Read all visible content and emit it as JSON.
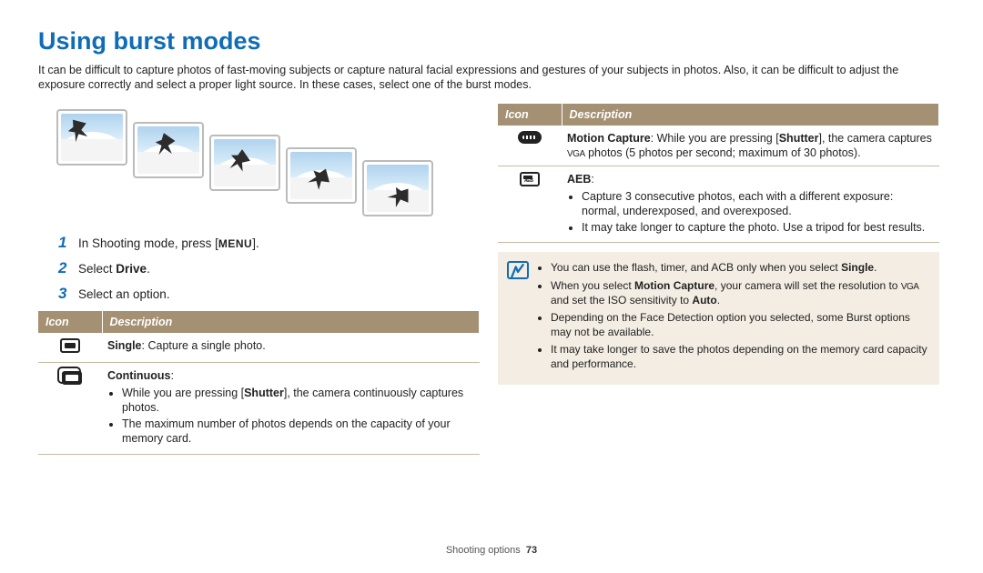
{
  "title": "Using burst modes",
  "intro": "It can be difficult to capture photos of fast-moving subjects or capture natural facial expressions and gestures of your subjects in photos. Also, it can be difficult to adjust the exposure correctly and select a proper light source. In these cases, select one of the burst modes.",
  "steps": {
    "n1": "1",
    "s1_pre": "In Shooting mode, press [",
    "s1_menu": "MENU",
    "s1_post": "].",
    "n2": "2",
    "s2_pre": "Select ",
    "s2_bold": "Drive",
    "s2_post": ".",
    "n3": "3",
    "s3": "Select an option."
  },
  "headers": {
    "icon": "Icon",
    "desc": "Description"
  },
  "rows_left": {
    "single": {
      "bold": "Single",
      "rest": ": Capture a single photo."
    },
    "continuous": {
      "bold": "Continuous",
      "colon": ":",
      "li1a": "While you are pressing [",
      "li1b": "Shutter",
      "li1c": "], the camera continuously captures photos.",
      "li2": "The maximum number of photos depends on the capacity of your memory card."
    }
  },
  "rows_right": {
    "motion": {
      "bold": "Motion Capture",
      "t1": ": While you are pressing [",
      "t1b": "Shutter",
      "t2": "], the camera captures ",
      "vga": "VGA",
      "t3": " photos (5 photos per second; maximum of 30 photos)."
    },
    "aeb": {
      "bold": "AEB",
      "colon": ":",
      "li1": "Capture 3 consecutive photos, each with a different exposure: normal, underexposed, and overexposed.",
      "li2": "It may take longer to capture the photo. Use a tripod for best results."
    }
  },
  "note": {
    "li1a": "You can use the flash, timer, and ACB only when you select ",
    "li1b": "Single",
    "li1c": ".",
    "li2a": "When you select ",
    "li2b": "Motion Capture",
    "li2c": ", your camera will set the resolution to ",
    "li2vga": "VGA",
    "li2d": " and set the ISO sensitivity to ",
    "li2e": "Auto",
    "li2f": ".",
    "li3": "Depending on the Face Detection option you selected, some Burst options may not be available.",
    "li4": "It may take longer to save the photos depending on the memory card capacity and performance."
  },
  "footer": {
    "section": "Shooting options",
    "page": "73"
  }
}
